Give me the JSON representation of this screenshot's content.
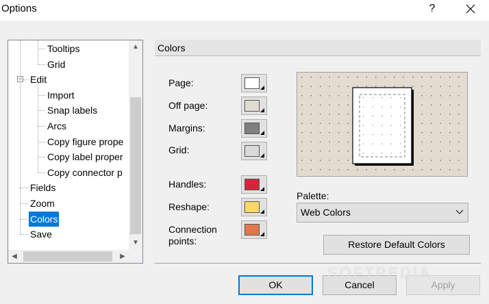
{
  "window": {
    "title": "Options",
    "help_label": "?"
  },
  "tree": {
    "items": [
      {
        "label": "Tooltips",
        "level": 1,
        "selected": false
      },
      {
        "label": "Grid",
        "level": 1,
        "selected": false
      },
      {
        "label": "Edit",
        "level": 0,
        "expander": "−",
        "selected": false
      },
      {
        "label": "Import",
        "level": 1,
        "selected": false
      },
      {
        "label": "Snap labels",
        "level": 1,
        "selected": false
      },
      {
        "label": "Arcs",
        "level": 1,
        "selected": false
      },
      {
        "label": "Copy figure prope",
        "level": 1,
        "selected": false
      },
      {
        "label": "Copy label proper",
        "level": 1,
        "selected": false
      },
      {
        "label": "Copy connector p",
        "level": 1,
        "selected": false
      },
      {
        "label": "Fields",
        "level": 0,
        "selected": false
      },
      {
        "label": "Zoom",
        "level": 0,
        "selected": false
      },
      {
        "label": "Colors",
        "level": 0,
        "selected": true
      },
      {
        "label": "Save",
        "level": 0,
        "selected": false
      }
    ]
  },
  "section": {
    "title": "Colors"
  },
  "colors": [
    {
      "label": "Page:",
      "color": "#ffffff"
    },
    {
      "label": "Off page:",
      "color": "#e2dbd0"
    },
    {
      "label": "Margins:",
      "color": "#7f7f7f"
    },
    {
      "label": "Grid:",
      "color": "#d9d9d9"
    },
    {
      "label": "Handles:",
      "color": "#d4263b"
    },
    {
      "label": "Reshape:",
      "color": "#ffd966"
    },
    {
      "label": "Connection\npoints:",
      "color": "#e0784a"
    }
  ],
  "palette": {
    "label": "Palette:",
    "value": "Web Colors"
  },
  "buttons": {
    "restore": "Restore Default Colors",
    "ok": "OK",
    "cancel": "Cancel",
    "apply": "Apply"
  },
  "watermark": "SOFTPEDIA"
}
